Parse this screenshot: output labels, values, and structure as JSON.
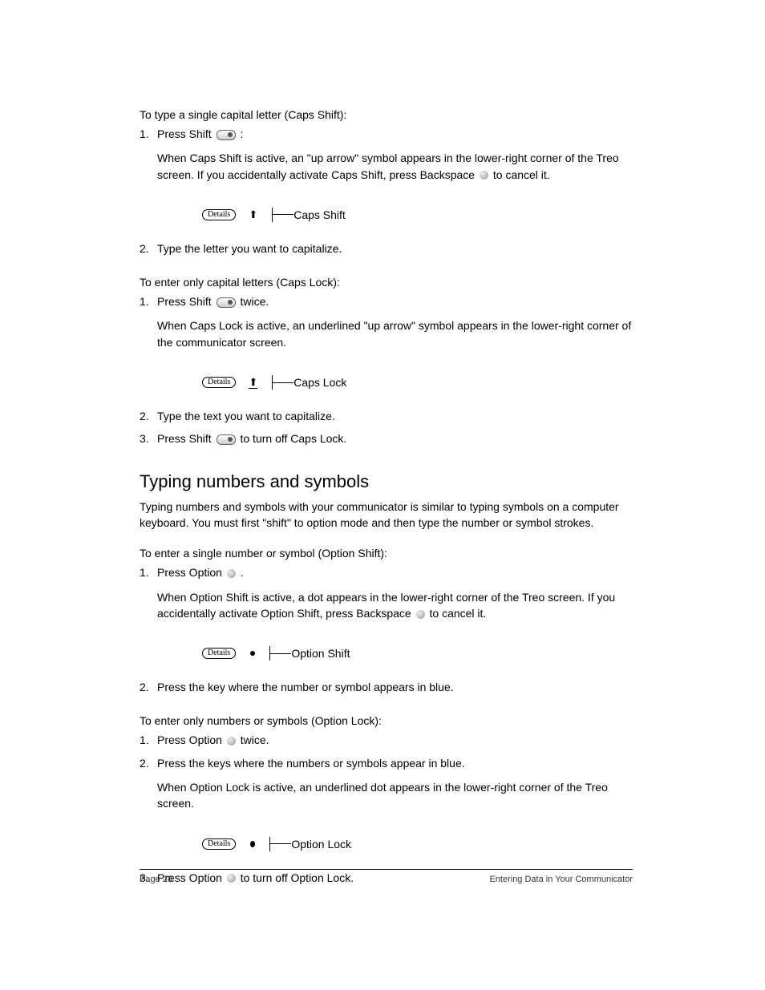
{
  "section1": {
    "heading": "To type a single capital letter (Caps Shift):",
    "step1_pre": "Press Shift ",
    "step1_post": ":",
    "step1_desc_a": "When Caps Shift is active, an \"up arrow\" symbol appears in the lower-right corner of the Treo screen. If you accidentally activate Caps Shift, press Backspace ",
    "step1_desc_b": " to cancel it.",
    "callout_btn": "Details",
    "callout_label": "Caps Shift",
    "step2": "Type the letter you want to capitalize."
  },
  "section2": {
    "heading": "To enter only capital letters (Caps Lock):",
    "step1_pre": "Press Shift ",
    "step1_post": " twice.",
    "step1_desc": "When Caps Lock is active, an underlined \"up arrow\" symbol appears in the lower-right corner of the communicator screen.",
    "callout_btn": "Details",
    "callout_label": "Caps Lock",
    "step2": "Type the text you want to capitalize.",
    "step3_pre": "Press Shift ",
    "step3_post": " to turn off Caps Lock."
  },
  "heading2": "Typing numbers and symbols",
  "intro": "Typing numbers and symbols with your communicator is similar to typing symbols on a computer keyboard. You must first \"shift\" to option mode and then type the number or symbol strokes.",
  "section3": {
    "heading": "To enter a single number or symbol (Option Shift):",
    "step1_pre": "Press Option ",
    "step1_post": ".",
    "step1_desc_a": "When Option Shift is active, a dot appears in the lower-right corner of the Treo screen. If you accidentally activate Option Shift, press Backspace ",
    "step1_desc_b": " to cancel it.",
    "callout_btn": "Details",
    "callout_label": "Option Shift",
    "step2": "Press the key where the number or symbol appears in blue."
  },
  "section4": {
    "heading": "To enter only numbers or symbols (Option Lock):",
    "step1_pre": "Press Option ",
    "step1_post": " twice.",
    "step2": "Press the keys where the numbers or symbols appear in blue.",
    "step2_desc": "When Option Lock is active, an underlined dot appears in the lower-right corner of the Treo screen.",
    "callout_btn": "Details",
    "callout_label": "Option Lock",
    "step3_pre": "Press Option ",
    "step3_post": " to turn off Option Lock."
  },
  "footer": {
    "page": "Page 28",
    "chapter": "Entering Data in Your Communicator"
  }
}
